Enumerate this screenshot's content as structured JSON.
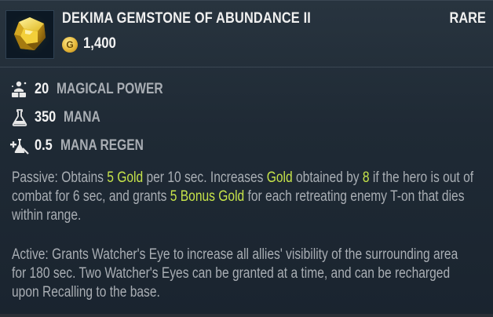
{
  "item": {
    "name": "DEKIMA GEMSTONE OF ABUNDANCE II",
    "rarity": "RARE",
    "currency_symbol": "G",
    "price": "1,400",
    "icon": "yellow-gemstone-icon"
  },
  "stats": [
    {
      "value": "20",
      "label": "MAGICAL POWER",
      "icon": "magical-power-icon"
    },
    {
      "value": "350",
      "label": "MANA",
      "icon": "mana-flask-icon"
    },
    {
      "value": "0.5",
      "label": "MANA REGEN",
      "icon": "mana-regen-icon"
    }
  ],
  "passive": {
    "l1a": "Passive: Obtains ",
    "l1b": "5 Gold",
    "l1c": " per 10 sec. Increases ",
    "l1d": "Gold",
    "l1e": " obtained by ",
    "l1f": "8",
    "l1g": " if the hero is out of",
    "l2a": "combat for 6 sec, and grants ",
    "l2b": "5 Bonus Gold",
    "l2c": " for each retreating enemy T-on that dies",
    "l3": "within range."
  },
  "active": {
    "l1": "Active: Grants Watcher's Eye to increase all allies' visibility of the surrounding area",
    "l2": "for 180 sec. Two Watcher's Eyes can be granted at a time, and can be recharged",
    "l3": "upon Recalling to the base."
  },
  "colors": {
    "highlight": "#c6e34a",
    "body_text": "#a9aeb4",
    "title_text": "#f0f0f0",
    "background": "#1f2a35"
  }
}
